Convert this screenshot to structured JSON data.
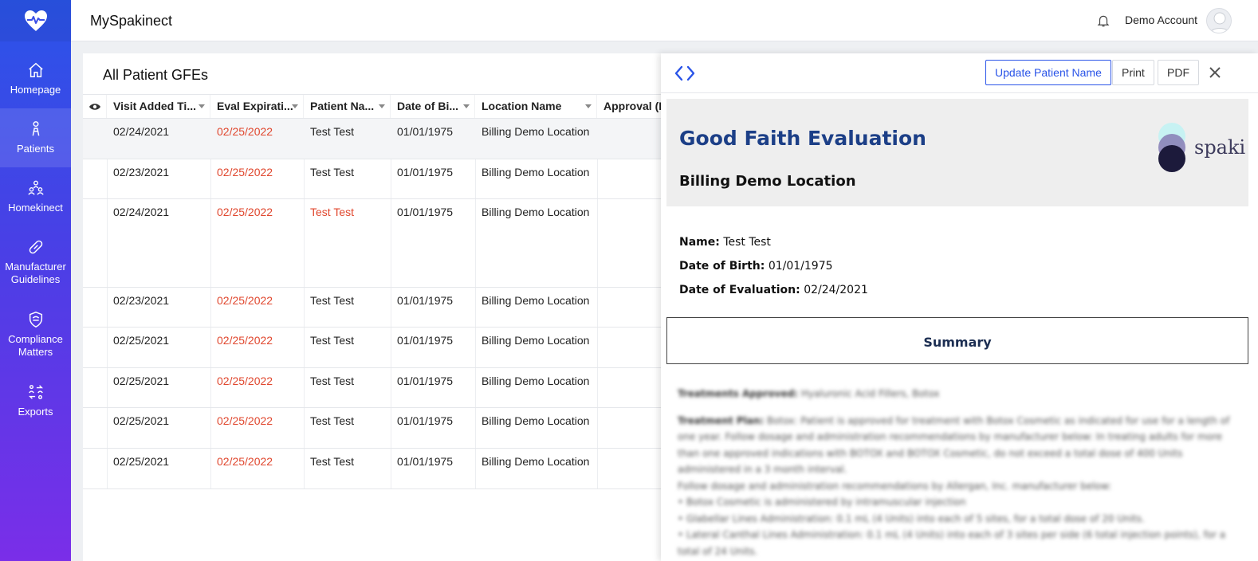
{
  "app": {
    "title": "MySpakinect"
  },
  "sidebar": {
    "items": [
      {
        "label": "Homepage",
        "icon": "home-icon",
        "active": false
      },
      {
        "label": "Patients",
        "icon": "patient-icon",
        "active": true
      },
      {
        "label": "Homekinect",
        "icon": "people-icon",
        "active": false
      },
      {
        "label": "Manufacturer Guidelines",
        "icon": "bandage-icon",
        "active": false
      },
      {
        "label": "Compliance Matters",
        "icon": "shield-icon",
        "active": false
      },
      {
        "label": "Exports",
        "icon": "transfer-icon",
        "active": false
      }
    ]
  },
  "header": {
    "account_name": "Demo Account"
  },
  "table": {
    "title": "All Patient GFEs",
    "columns": [
      "Visit Added Ti...",
      "Eval Expirati...",
      "Patient Na...",
      "Date of Bi...",
      "Location Name",
      "Approval (P"
    ],
    "rows": [
      {
        "visit_added": "02/24/2021",
        "eval_expiration": "02/25/2022",
        "patient_name": "Test Test",
        "dob": "01/01/1975",
        "location": "Billing Demo Location"
      },
      {
        "visit_added": "02/23/2021",
        "eval_expiration": "02/25/2022",
        "patient_name": "Test Test",
        "dob": "01/01/1975",
        "location": "Billing Demo Location"
      },
      {
        "visit_added": "02/24/2021",
        "eval_expiration": "02/25/2022",
        "patient_name": "Test Test",
        "dob": "01/01/1975",
        "location": "Billing Demo Location"
      },
      {
        "visit_added": "02/23/2021",
        "eval_expiration": "02/25/2022",
        "patient_name": "Test Test",
        "dob": "01/01/1975",
        "location": "Billing Demo Location"
      },
      {
        "visit_added": "02/25/2021",
        "eval_expiration": "02/25/2022",
        "patient_name": "Test Test",
        "dob": "01/01/1975",
        "location": "Billing Demo Location"
      },
      {
        "visit_added": "02/25/2021",
        "eval_expiration": "02/25/2022",
        "patient_name": "Test Test",
        "dob": "01/01/1975",
        "location": "Billing Demo Location"
      },
      {
        "visit_added": "02/25/2021",
        "eval_expiration": "02/25/2022",
        "patient_name": "Test Test",
        "dob": "01/01/1975",
        "location": "Billing Demo Location"
      },
      {
        "visit_added": "02/25/2021",
        "eval_expiration": "02/25/2022",
        "patient_name": "Test Test",
        "dob": "01/01/1975",
        "location": "Billing Demo Location"
      }
    ]
  },
  "detail": {
    "buttons": {
      "update_name": "Update Patient Name",
      "print": "Print",
      "pdf": "PDF"
    },
    "title": "Good Faith Evaluation",
    "location": "Billing Demo Location",
    "logo_text": "spaki",
    "name_label": "Name:",
    "name_value": "Test Test",
    "dob_label": "Date of Birth:",
    "dob_value": "01/01/1975",
    "eval_label": "Date of Evaluation:",
    "eval_value": "02/24/2021",
    "summary_heading": "Summary",
    "blurred": {
      "treatments_label": "Treatments Approved:",
      "treatments_value": "Hyaluronic Acid Fillers, Botox",
      "plan_label": "Treatment Plan:",
      "plan_text": "Botox: Patient is approved for treatment with Botox Cosmetic as indicated for use for a length of one year. Follow dosage and administration recommendations by manufacturer below: In treating adults for more than one approved indications with BOTOX and BOTOX Cosmetic, do not exceed a total dose of 400 Units administered in a 3 month interval.",
      "follow_text": "Follow dosage and administration recommendations by Allergan, Inc. manufacturer below:",
      "bullets": [
        "• Botox Cosmetic is administered by intramuscular injection",
        "• Glabellar Lines Administration: 0.1 mL (4 Units) into each of 5 sites, for a total dose of 20 Units.",
        "• Lateral Canthal Lines Administration: 0.1 mL (4 Units) into each of 3 sites per side (6 total injection points), for a total of 24 Units."
      ]
    }
  }
}
